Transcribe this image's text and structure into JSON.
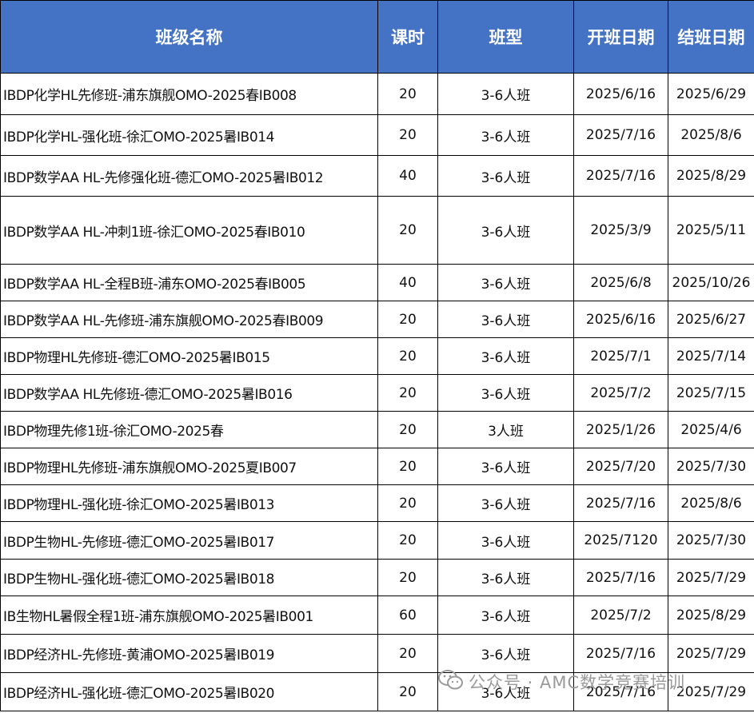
{
  "table": {
    "headers": [
      "班级名称",
      "课时",
      "班型",
      "开班日期",
      "结班日期"
    ],
    "rows": [
      [
        "IBDP化学HL先修班-浦东旗舰OMO-2025春IB008",
        "20",
        "3-6人班",
        "2025/6/16",
        "2025/6/29"
      ],
      [
        "IBDP化学HL-强化班-徐汇OMO-2025暑IB014",
        "20",
        "3-6人班",
        "2025/7/16",
        "2025/8/6"
      ],
      [
        "IBDP数学AA HL-先修强化班-德汇OMO-2025暑IB012",
        "40",
        "3-6人班",
        "2025/7/16",
        "2025/8/29"
      ],
      [
        "IBDP数学AA HL-冲刺1班-徐汇OMO-2025春IB010",
        "20",
        "3-6人班",
        "2025/3/9",
        "2025/5/11"
      ],
      [
        "IBDP数学AA HL-全程B班-浦东OMO-2025春IB005",
        "40",
        "3-6人班",
        "2025/6/8",
        "2025/10/26"
      ],
      [
        "IBDP数学AA HL-先修班-浦东旗舰OMO-2025春IB009",
        "20",
        "3-6人班",
        "2025/6/16",
        "2025/6/27"
      ],
      [
        "IBDP物理HL先修班-德汇OMO-2025暑IB015",
        "20",
        "3-6人班",
        "2025/7/1",
        "2025/7/14"
      ],
      [
        "IBDP数学AA HL先修班-德汇OMO-2025暑IB016",
        "20",
        "3-6人班",
        "2025/7/2",
        "2025/7/15"
      ],
      [
        "IBDP物理先修1班-徐汇OMO-2025春",
        "20",
        "3人班",
        "2025/1/26",
        "2025/4/6"
      ],
      [
        "IBDP物理HL先修班-浦东旗舰OMO-2025夏IB007",
        "20",
        "3-6人班",
        "2025/7/20",
        "2025/7/30"
      ],
      [
        "IBDP物理HL-强化班-徐汇OMO-2025暑IB013",
        "20",
        "3-6人班",
        "2025/7/16",
        "2025/8/6"
      ],
      [
        "IBDP生物HL-先修班-德汇OMO-2025暑IB017",
        "20",
        "3-6人班",
        "2025/7120",
        "2025/7/30"
      ],
      [
        "IBDP生物HL-强化班-德汇OMO-2025暑IB018",
        "20",
        "3-6人班",
        "2025/7/16",
        "2025/7/29"
      ],
      [
        "IB生物HL暑假全程1班-浦东旗舰OMO-2025暑IB001",
        "60",
        "3-6人班",
        "2025/7/2",
        "2025/8/29"
      ],
      [
        "IBDP经济HL-先修班-黄浦OMO-2025暑IB019",
        "20",
        "3-6人班",
        "2025/7/16",
        "2025/7/29"
      ],
      [
        "IBDP经济HL-强化班-德汇OMO-2025暑IB020",
        "20",
        "3-6人班",
        "2025/7/16",
        "2025/7/29"
      ]
    ]
  },
  "watermark": {
    "text": "公众号 · AMC数学竞赛培训",
    "icon": "wechat-icon"
  },
  "colors": {
    "header_bg": "#4472c4",
    "header_text": "#ffffff",
    "border": "#000000",
    "watermark": "#9a9a9a"
  }
}
